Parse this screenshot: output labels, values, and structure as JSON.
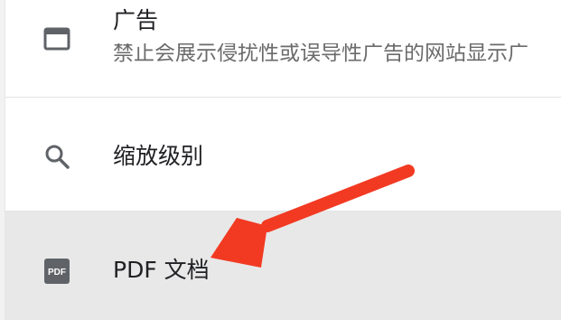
{
  "settings_list": {
    "ads": {
      "icon": "ads-window-icon",
      "title": "广告",
      "description": "禁止会展示侵扰性或误导性广告的网站显示广"
    },
    "zoom": {
      "icon": "search-icon",
      "title": "缩放级别"
    },
    "pdf": {
      "icon": "pdf-icon",
      "title": "PDF 文档",
      "icon_text": "PDF"
    }
  },
  "colors": {
    "annotation_arrow": "#f23a22",
    "highlight_row": "#e8e8e8",
    "icon": "#5f6368"
  }
}
